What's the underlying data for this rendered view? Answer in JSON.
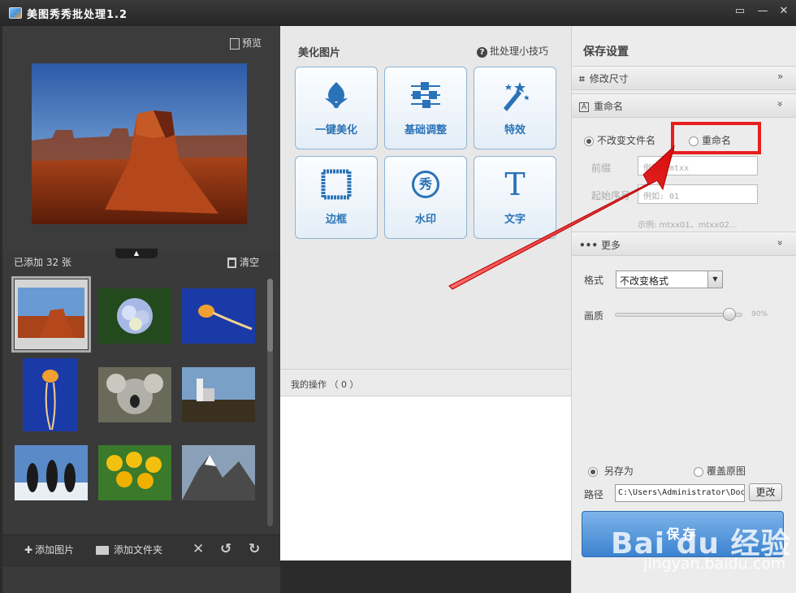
{
  "app": {
    "title": "美图秀秀批处理1.2"
  },
  "left_panel": {
    "preview_label": "预览",
    "added_count": "已添加 32 张",
    "clear_label": "清空",
    "bottom": {
      "add_image": "添加图片",
      "add_folder": "添加文件夹"
    }
  },
  "middle_panel": {
    "title": "美化图片",
    "tips": "批处理小技巧",
    "tools": [
      {
        "label": "一键美化",
        "icon": "tulip-icon"
      },
      {
        "label": "基础调整",
        "icon": "sliders-icon"
      },
      {
        "label": "特效",
        "icon": "magic-wand-icon"
      },
      {
        "label": "边框",
        "icon": "frame-icon"
      },
      {
        "label": "水印",
        "icon": "watermark-xiu-icon"
      },
      {
        "label": "文字",
        "icon": "text-t-icon"
      }
    ],
    "watermark_glyph": "秀",
    "text_glyph": "T",
    "operations": "我的操作 （ 0 ）"
  },
  "right_panel": {
    "title": "保存设置",
    "resize_section": "修改尺寸",
    "rename_section": "重命名",
    "rename_options": {
      "keep_name": "不改变文件名",
      "rename": "重命名"
    },
    "prefix_label": "前缀",
    "prefix_placeholder": "例如: mtxx",
    "start_label": "起始序号",
    "start_placeholder": "例如: 01",
    "example": "示例: mtxx01、mtxx02...",
    "more_section": "更多",
    "format_label": "格式",
    "format_value": "不改变格式",
    "quality_label": "画质",
    "quality_value": "90%",
    "quality_level": 0.9,
    "save_as": "另存为",
    "overwrite": "覆盖原图",
    "path_label": "路径",
    "path_value": "C:\\Users\\Administrator\\Documents",
    "change_button": "更改",
    "save_button": "保存"
  },
  "watermark": {
    "logo": "Bai du 经验",
    "url": "jingyan.baidu.com"
  },
  "colors": {
    "accent": "#2a73b8",
    "highlight": "#e61e1e",
    "arrow": "#e61e1e"
  }
}
